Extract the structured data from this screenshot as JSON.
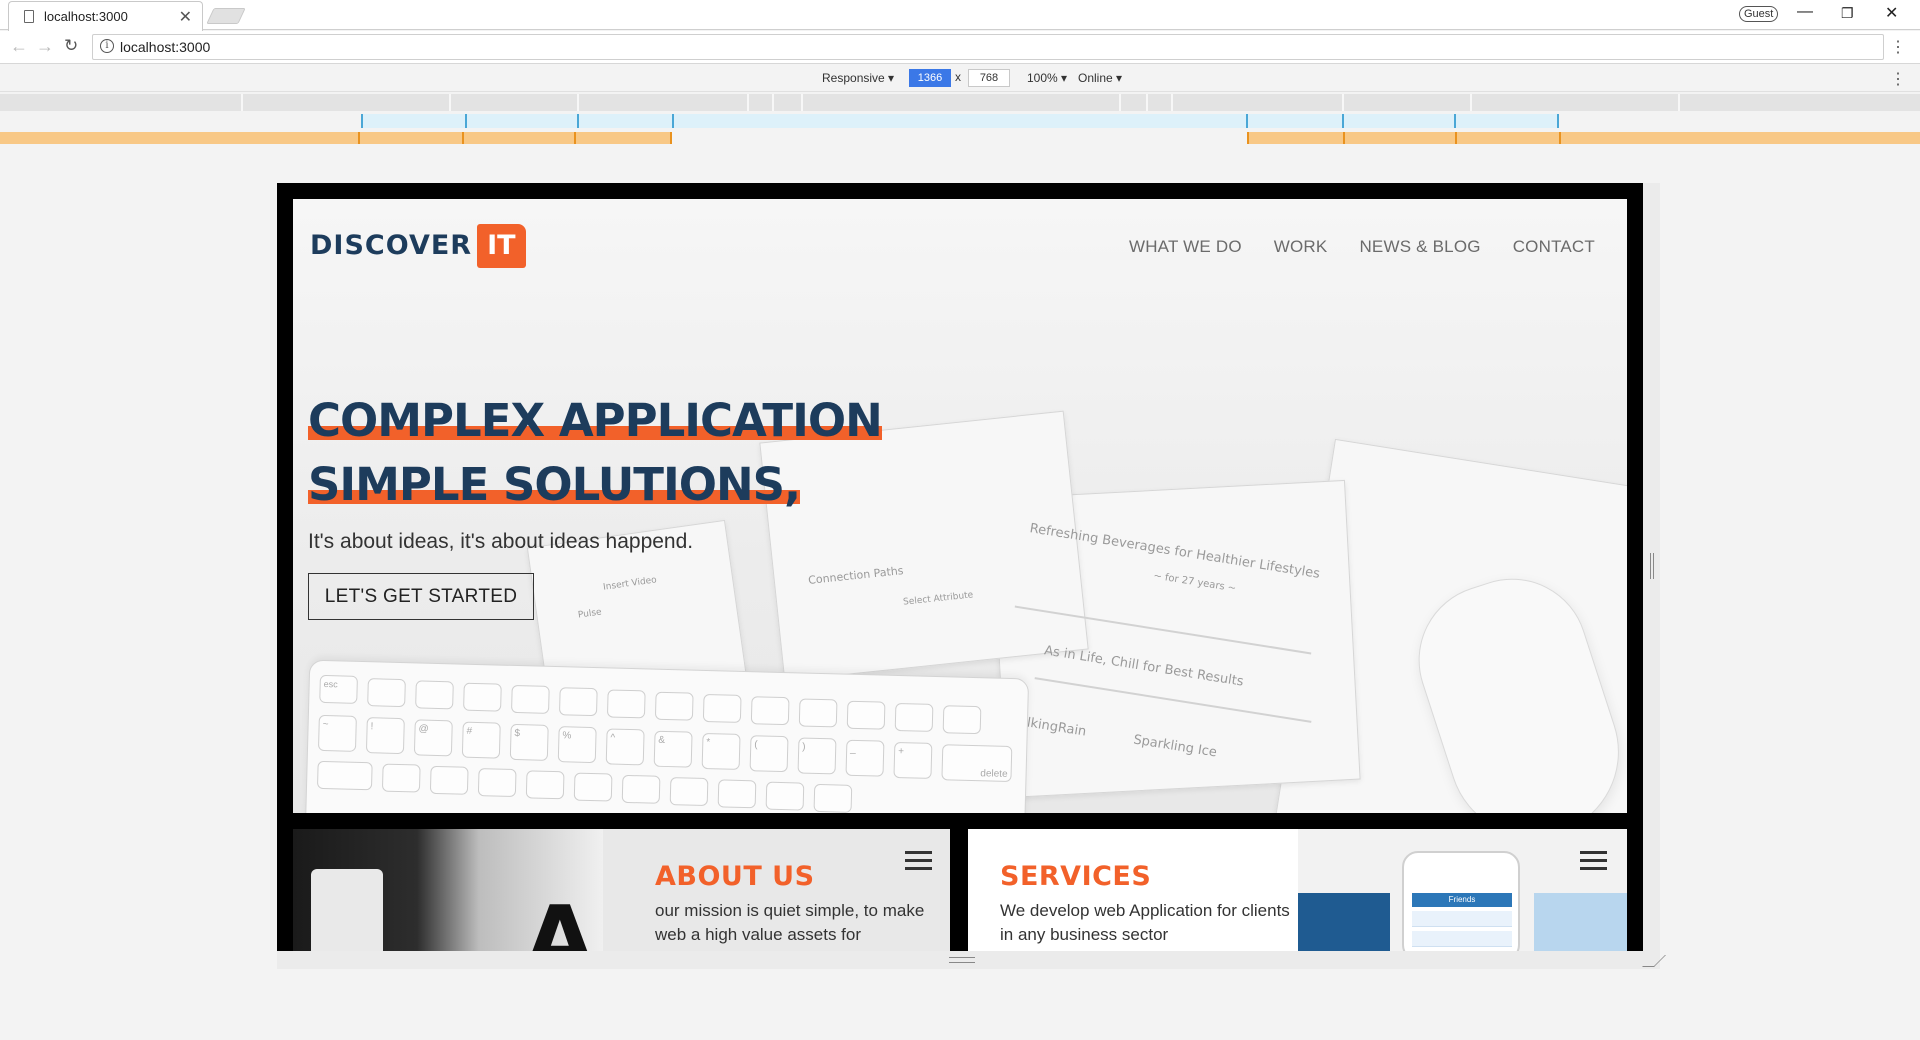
{
  "browser": {
    "tab_title": "localhost:3000",
    "tab_close": "✕",
    "profile": "Guest",
    "url": "localhost:3000",
    "window_controls": {
      "minimize": "—",
      "restore": "❐",
      "close": "✕"
    }
  },
  "devtools": {
    "device": "Responsive ▾",
    "width": "1366",
    "times": "x",
    "height": "768",
    "zoom": "100% ▾",
    "network": "Online ▾"
  },
  "site": {
    "logo_word": "DISCOVER",
    "logo_badge": "IT",
    "nav": [
      "WHAT WE DO",
      "WORK",
      "NEWS & BLOG",
      "CONTACT"
    ],
    "headline_1": "COMPLEX APPLICATION",
    "headline_2": "SIMPLE SOLUTIONS,",
    "tagline": "It's about ideas, it's about ideas happend.",
    "cta": "LET'S GET STARTED",
    "about": {
      "title": "ABOUT US",
      "text": "our mission is quiet simple, to make web a high value assets for"
    },
    "services": {
      "title": "SERVICES",
      "text": "We develop web Application for clients in any business sector"
    },
    "sketch_texts": [
      "Refreshing Beverages for Healthier Lifestyles",
      "~ for 27 years ~",
      "As in Life, Chill for Best Results",
      "TalkingRain",
      "Sparkling Ice",
      "Connection Paths",
      "Select Attribute",
      "Pulse",
      "Insert Video"
    ],
    "keyboard_keys": [
      "esc",
      "~",
      "!",
      "@",
      "#",
      "$",
      "%",
      "^",
      "&",
      "*",
      "(",
      ")",
      "_",
      "+",
      "delete"
    ],
    "phone_header": "Friends",
    "colors": {
      "accent": "#f2612a",
      "navy": "#1d3c5c"
    }
  }
}
